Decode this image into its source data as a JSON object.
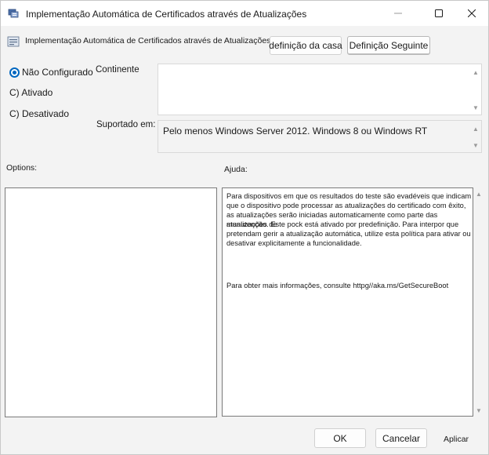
{
  "window": {
    "title": "Implementação Automática de Certificados através de Atualizações",
    "minimize_icon": "minimize-icon",
    "maximize_icon": "maximize-icon",
    "close_icon": "close-icon"
  },
  "header": {
    "policy_name": "Implementação Automática de Certificados através de Atualizações",
    "prev_button": "definição da casa",
    "next_button": "Definição Seguinte"
  },
  "state": {
    "options": [
      {
        "label": "Não Configurado",
        "selected": true
      },
      {
        "label": "C) Ativado",
        "selected": false
      },
      {
        "label": "C) Desativado",
        "selected": false
      }
    ]
  },
  "comment": {
    "label": "Continente",
    "value": ""
  },
  "supported": {
    "label": "Suportado em:",
    "value": "Pelo menos Windows Server 2012. Windows 8 ou Windows RT"
  },
  "options_panel": {
    "label": "Options:"
  },
  "help_panel": {
    "label": "Ajuda:",
    "lines": [
      "Para dispositivos em que os resultados do teste são evadéveis que indicam",
      "que o dispositivo pode processar as atualizações do certificado com êxito,",
      "as atualizações serão iniciadas automaticamente como parte das atualizações de",
      "manutenção. Este pock está ativado por predefinição. Para interpor que",
      "pretendam gerir a atualização automática, utilize esta política para ativar ou",
      "desativar explicitamente a funcionalidade."
    ],
    "more_info": "Para obter mais informações, consulte httpg//aka.ms/GetSecureBoot"
  },
  "footer": {
    "ok": "OK",
    "cancel": "Cancelar",
    "apply": "Aplicar"
  },
  "colors": {
    "accent": "#0067c0",
    "window_bg": "#f3f3f3"
  }
}
